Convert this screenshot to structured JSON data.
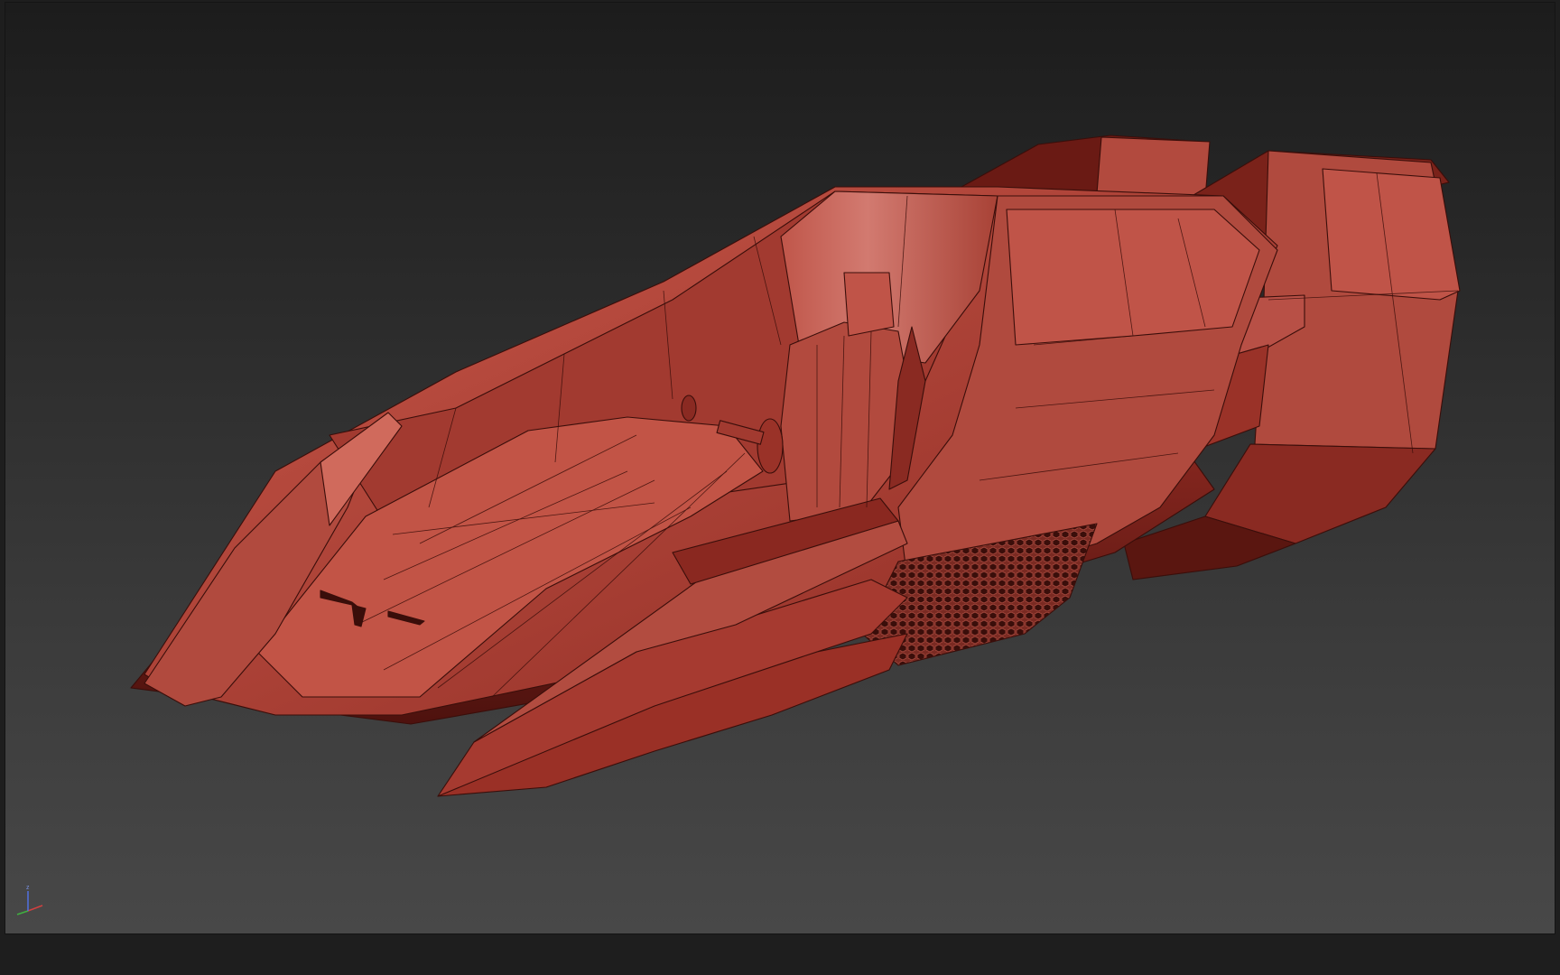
{
  "viewport": {
    "background_top": "#1c1c1c",
    "background_bottom": "#484848"
  },
  "model": {
    "base_color": "#b84a3e",
    "light_color": "#d06050",
    "dark_color": "#6e1e18",
    "edge_color": "#3a0e0a"
  },
  "axis_gizmo": {
    "x_color": "#d04040",
    "y_color": "#40b040",
    "z_color": "#5070e0",
    "z_label": "z"
  }
}
